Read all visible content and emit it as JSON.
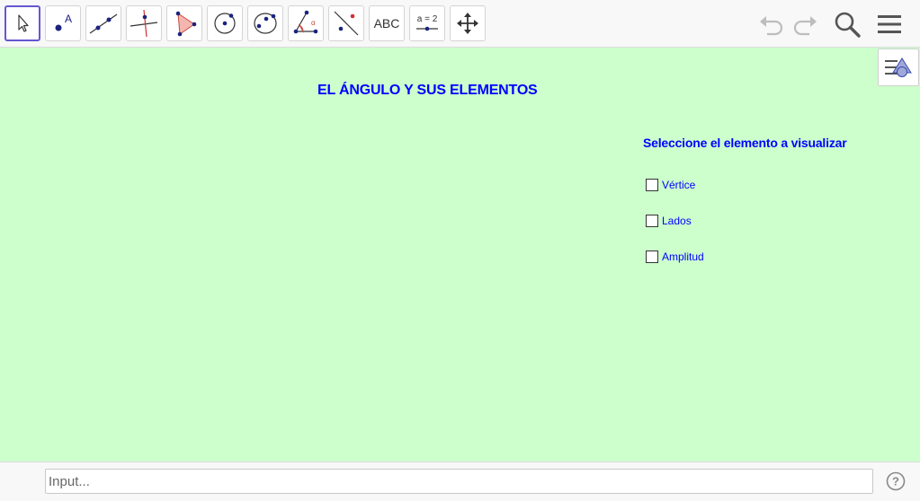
{
  "toolbar": {
    "tools": [
      {
        "name": "move-tool",
        "icon": "cursor-arrow-icon",
        "selected": true
      },
      {
        "name": "point-tool",
        "icon": "point-icon"
      },
      {
        "name": "line-tool",
        "icon": "line-icon"
      },
      {
        "name": "perpendicular-tool",
        "icon": "perpendicular-icon"
      },
      {
        "name": "polygon-tool",
        "icon": "polygon-icon"
      },
      {
        "name": "circle-tool",
        "icon": "circle-icon"
      },
      {
        "name": "conic-tool",
        "icon": "conic-icon"
      },
      {
        "name": "angle-tool",
        "icon": "angle-icon"
      },
      {
        "name": "reflect-tool",
        "icon": "reflect-icon"
      },
      {
        "name": "text-tool",
        "label": "ABC"
      },
      {
        "name": "slider-tool",
        "label": "a = 2"
      },
      {
        "name": "move-graphics-tool",
        "icon": "move-arrows-icon"
      }
    ],
    "undo_icon": "undo-icon",
    "redo_icon": "redo-icon",
    "search_icon": "search-icon",
    "menu_icon": "menu-icon"
  },
  "graphics": {
    "title": "EL ÁNGULO Y SUS ELEMENTOS",
    "caption": "Seleccione el elemento a visualizar",
    "checkboxes": [
      {
        "label": "Vértice",
        "checked": false
      },
      {
        "label": "Lados",
        "checked": false
      },
      {
        "label": "Amplitud",
        "checked": false
      }
    ],
    "background": "#ccffcc",
    "text_color": "#0000ff"
  },
  "inputbar": {
    "placeholder": "Input..."
  },
  "colors": {
    "accent": "#6557d2",
    "point": "#1a237e"
  }
}
